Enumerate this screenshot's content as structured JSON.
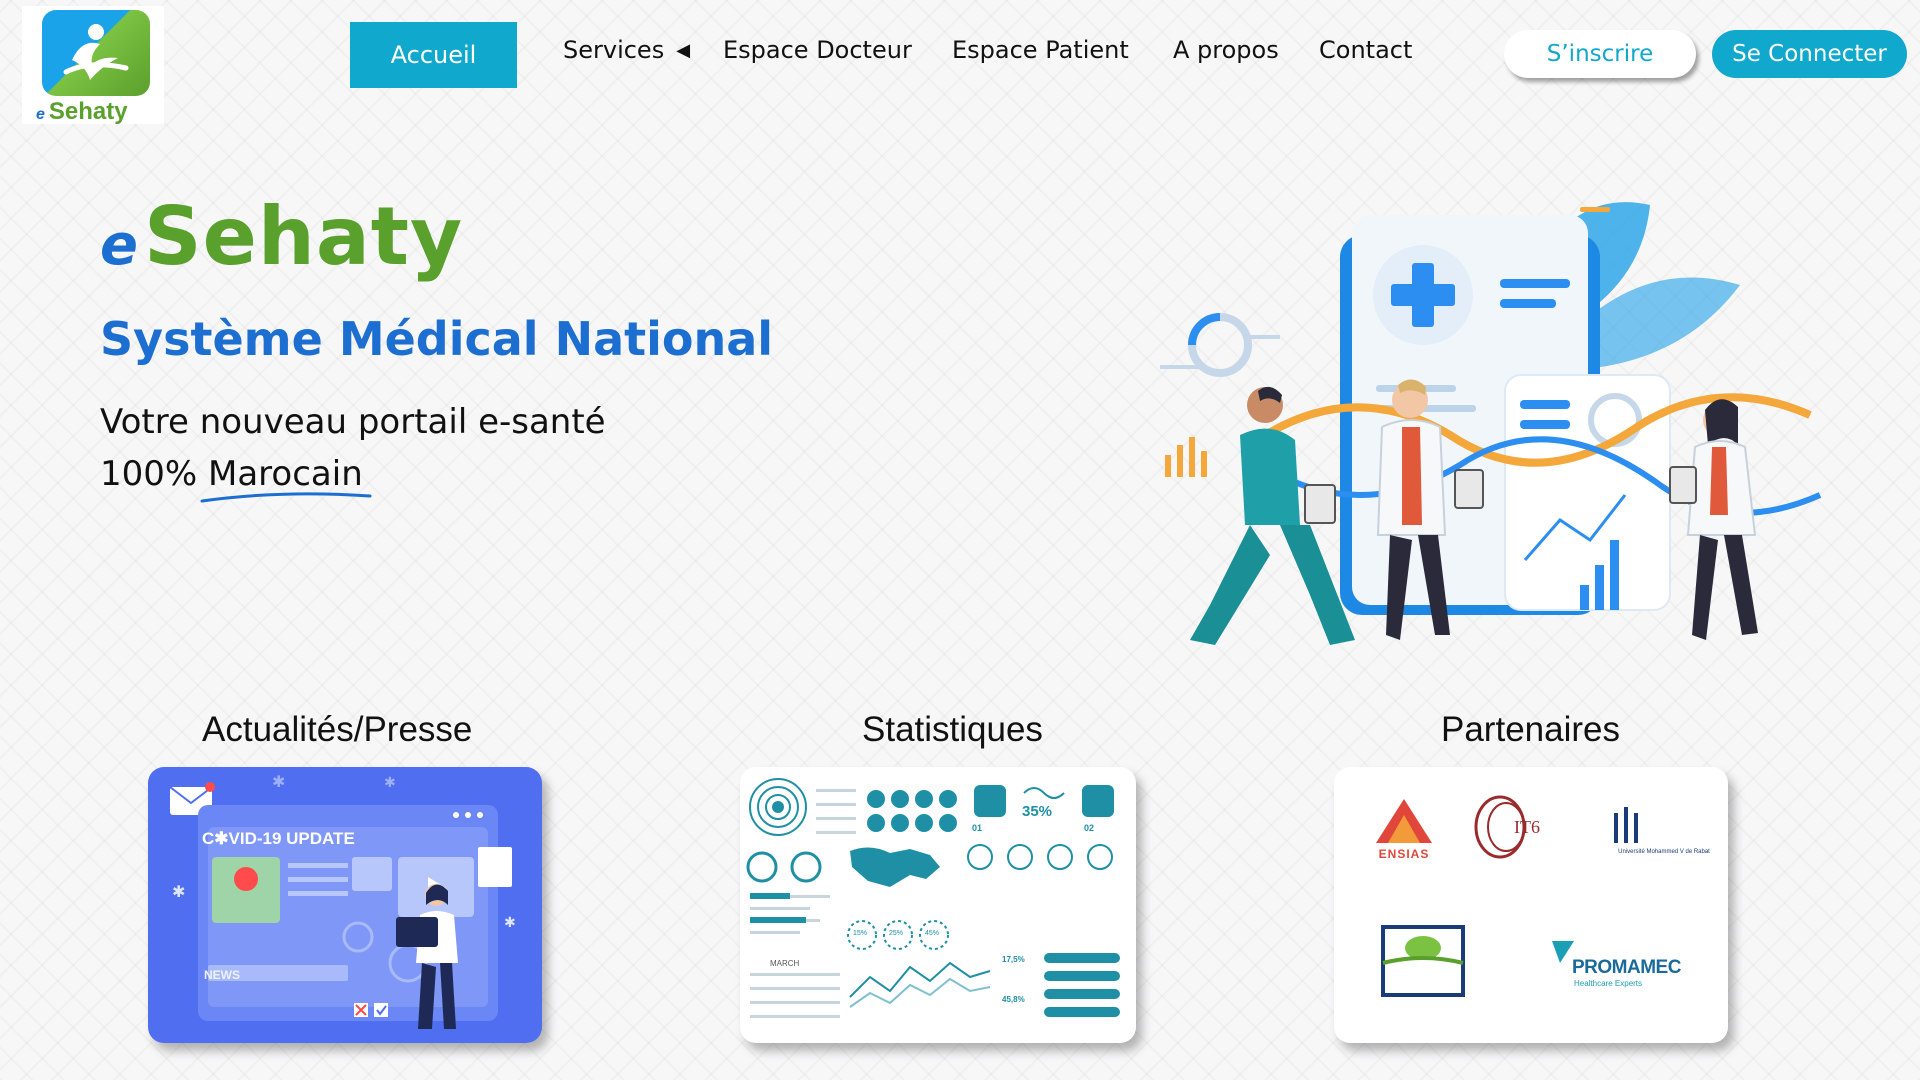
{
  "header": {
    "logo": {
      "prefix": "e",
      "name": "Sehaty"
    },
    "nav": {
      "home": "Accueil",
      "services": "Services",
      "doctor_space": "Espace Docteur",
      "patient_space": "Espace Patient",
      "about": "A propos",
      "contact": "Contact"
    },
    "signup": "S’inscrire",
    "login": "Se Connecter"
  },
  "hero": {
    "brand_prefix": "e",
    "brand_name": "Sehaty",
    "subtitle": "Système Médical National",
    "tagline_line1": "Votre nouveau portail e-santé",
    "tagline_pct": "100%",
    "tagline_word": "Marocain"
  },
  "sections": {
    "news": {
      "title": "Actualités/Presse",
      "card_title": "C✱VID-19 UPDATE",
      "card_label": "NEWS"
    },
    "stats": {
      "title": "Statistiques",
      "kpi_top": "35%",
      "kpi_a": "15%",
      "kpi_b": "25%",
      "kpi_c": "45%",
      "kpi_d": "17,5%",
      "kpi_e": "45,8%",
      "month": "MARCH",
      "index_01": "01",
      "index_02": "02"
    },
    "partners": {
      "title": "Partenaires",
      "ensias": "ENSIAS",
      "it6": "IT6",
      "university": "Université Mohammed V de Rabat",
      "promamec": "PROMAMEC",
      "promamec_sub": "Healthcare Experts"
    }
  },
  "colors": {
    "accent": "#10a8cc",
    "brand_blue": "#1c6fd0",
    "brand_green": "#5aa02c"
  }
}
